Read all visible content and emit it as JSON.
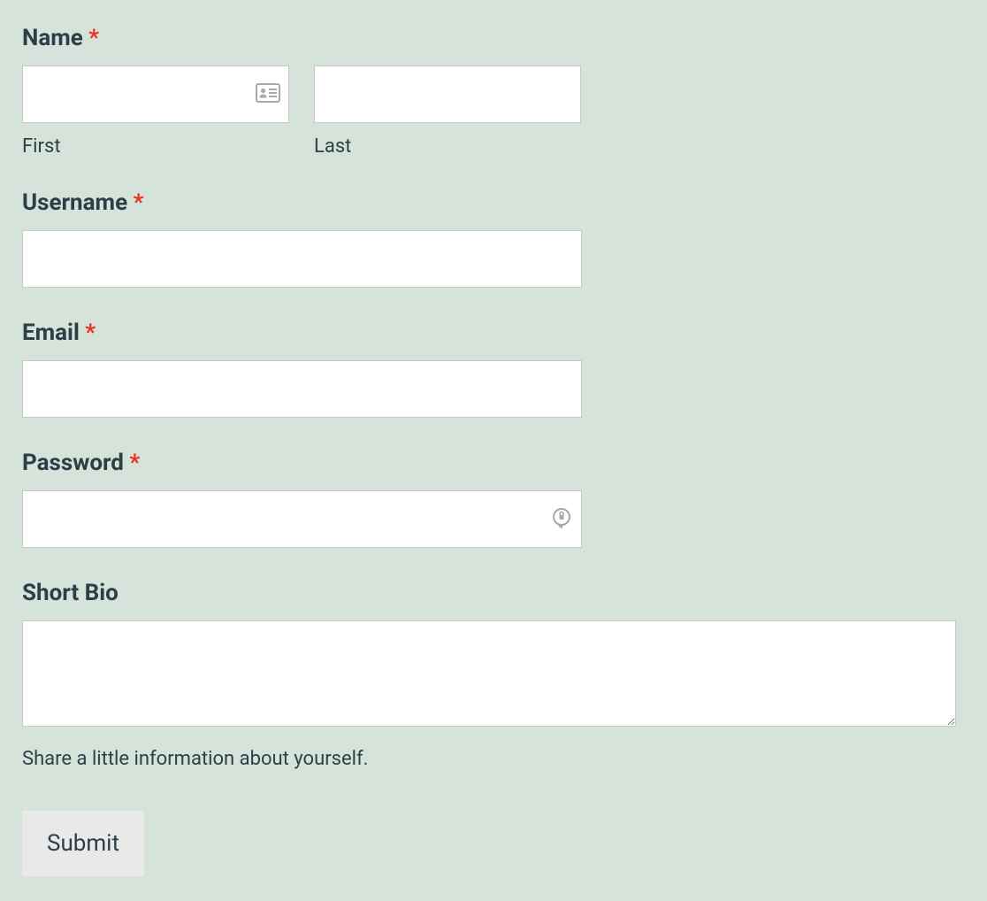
{
  "form": {
    "name": {
      "label": "Name",
      "required_mark": "*",
      "first": {
        "sublabel": "First",
        "value": ""
      },
      "last": {
        "sublabel": "Last",
        "value": ""
      }
    },
    "username": {
      "label": "Username",
      "required_mark": "*",
      "value": ""
    },
    "email": {
      "label": "Email",
      "required_mark": "*",
      "value": ""
    },
    "password": {
      "label": "Password",
      "required_mark": "*",
      "value": ""
    },
    "bio": {
      "label": "Short Bio",
      "value": "",
      "hint": "Share a little information about yourself."
    },
    "submit": {
      "label": "Submit"
    }
  }
}
